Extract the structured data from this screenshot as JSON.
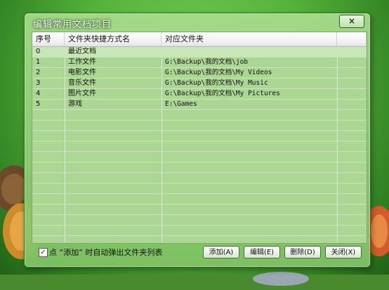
{
  "window": {
    "title": "编辑常用文档项目",
    "close_label": "×"
  },
  "columns": [
    "序号",
    "文件夹快捷方式名",
    "对应文件夹"
  ],
  "rows": [
    {
      "index": "0",
      "name": "最近文档",
      "path": ""
    },
    {
      "index": "1",
      "name": "工作文件",
      "path": "G:\\Backup\\我的文档\\job"
    },
    {
      "index": "2",
      "name": "电影文件",
      "path": "G:\\Backup\\我的文档\\My Videos"
    },
    {
      "index": "3",
      "name": "音乐文件",
      "path": "G:\\Backup\\我的文档\\My Music"
    },
    {
      "index": "4",
      "name": "图片文件",
      "path": "G:\\Backup\\我的文档\\My Pictures"
    },
    {
      "index": "5",
      "name": "游戏",
      "path": "E:\\Games"
    }
  ],
  "footer": {
    "checkbox_checked": true,
    "checkbox_label": "点 “添加” 时自动弹出文件夹列表",
    "add_label": "添加(A)",
    "edit_label": "编辑(E)",
    "delete_label": "删除(D)",
    "close_label": "关闭(X)"
  },
  "colors": {
    "list_background": "#abd693",
    "selected_row": "#c7e8b6",
    "window_green": "#8cc870"
  }
}
